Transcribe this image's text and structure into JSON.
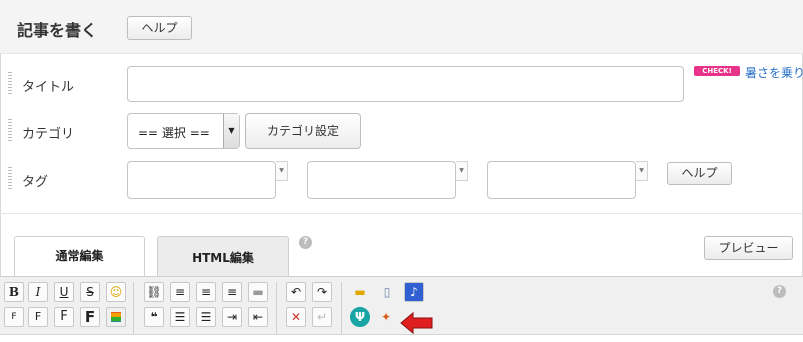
{
  "header": {
    "title": "記事を書く",
    "help_label": "ヘルプ"
  },
  "form": {
    "title_label": "タイトル",
    "title_value": "",
    "check_badge": "CHECK!",
    "check_link": "暑さを乗り",
    "category_label": "カテゴリ",
    "category_selected": "== 選択 ==",
    "category_button": "カテゴリ設定",
    "tag_label": "タグ",
    "tag_values": [
      "",
      "",
      ""
    ],
    "tag_help_label": "ヘルプ"
  },
  "tabs": [
    {
      "label": "通常編集",
      "active": true
    },
    {
      "label": "HTML編集",
      "active": false
    }
  ],
  "help_icon": "?",
  "preview_label": "プレビュー",
  "toolbar": {
    "row1": [
      {
        "name": "bold-icon",
        "glyph": "B"
      },
      {
        "name": "italic-icon",
        "glyph": "I"
      },
      {
        "name": "underline-icon",
        "glyph": "U"
      },
      {
        "name": "strikethrough-icon",
        "glyph": "S"
      },
      {
        "name": "emoji-icon",
        "glyph": "☺"
      },
      {
        "name": "link-icon",
        "glyph": "⛓"
      },
      {
        "name": "align-left-icon",
        "glyph": "≡"
      },
      {
        "name": "align-center-icon",
        "glyph": "≡"
      },
      {
        "name": "align-right-icon",
        "glyph": "≡"
      },
      {
        "name": "horizontal-rule-icon",
        "glyph": "▬"
      },
      {
        "name": "undo-icon",
        "glyph": "↶"
      },
      {
        "name": "redo-icon",
        "glyph": "↷"
      },
      {
        "name": "folder-icon",
        "glyph": "▬"
      },
      {
        "name": "book-icon",
        "glyph": "▯"
      },
      {
        "name": "music-icon",
        "glyph": "♪"
      }
    ],
    "row2": [
      {
        "name": "font-size-small-icon",
        "glyph": "F"
      },
      {
        "name": "font-size-medium-icon",
        "glyph": "F"
      },
      {
        "name": "font-size-large-icon",
        "glyph": "F"
      },
      {
        "name": "font-size-xlarge-icon",
        "glyph": "F"
      },
      {
        "name": "font-color-icon",
        "glyph": ""
      },
      {
        "name": "quote-icon",
        "glyph": "❝"
      },
      {
        "name": "bullet-list-icon",
        "glyph": "☰"
      },
      {
        "name": "numbered-list-icon",
        "glyph": "☰"
      },
      {
        "name": "indent-icon",
        "glyph": "⇥"
      },
      {
        "name": "outdent-icon",
        "glyph": "⇤"
      },
      {
        "name": "remove-format-icon",
        "glyph": "✕"
      },
      {
        "name": "line-break-icon",
        "glyph": "↵"
      },
      {
        "name": "restaurant-icon",
        "glyph": "Ψ"
      },
      {
        "name": "gift-icon",
        "glyph": "✦"
      }
    ]
  },
  "colors": {
    "accent_red": "#e02020",
    "check_pink": "#e8338a",
    "link_blue": "#2a72c9",
    "header_bg": "#f4f4f4"
  }
}
